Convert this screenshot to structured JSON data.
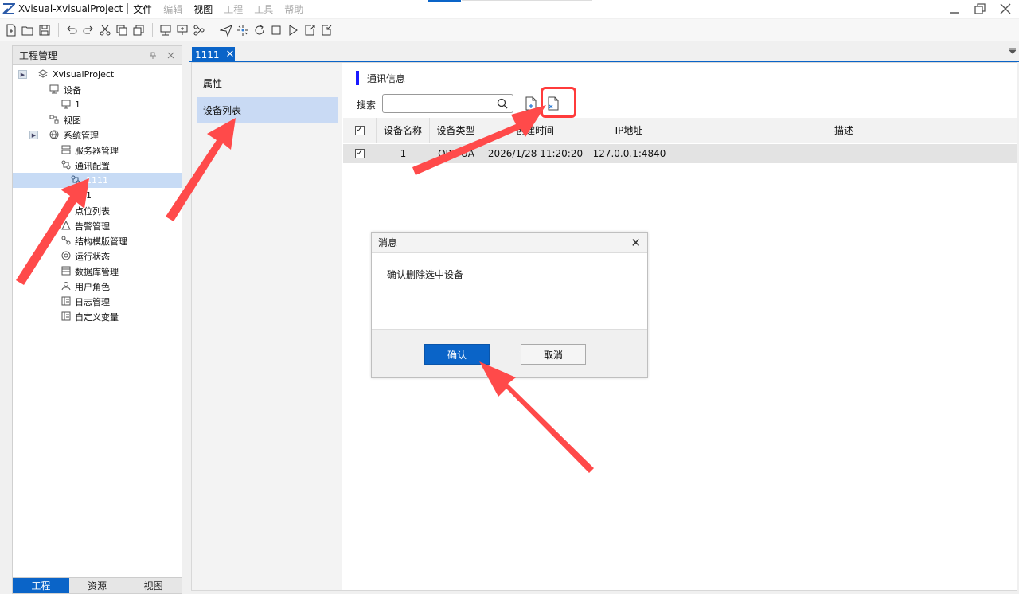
{
  "window": {
    "title": "Xvisual-XvisualProject",
    "menu": [
      {
        "label": "文件",
        "enabled": true
      },
      {
        "label": "编辑",
        "enabled": false
      },
      {
        "label": "视图",
        "enabled": true
      },
      {
        "label": "工程",
        "enabled": false
      },
      {
        "label": "工具",
        "enabled": false
      },
      {
        "label": "帮助",
        "enabled": false
      }
    ]
  },
  "left_panel": {
    "title": "工程管理",
    "tree": [
      {
        "label": "XvisualProject",
        "icon": "layers-icon"
      },
      {
        "label": "设备",
        "icon": "device-icon"
      },
      {
        "label": "1",
        "icon": "device-icon"
      },
      {
        "label": "视图",
        "icon": "view-icon"
      },
      {
        "label": "系统管理",
        "icon": "globe-icon"
      },
      {
        "label": "服务器管理",
        "icon": "server-icon"
      },
      {
        "label": "通讯配置",
        "icon": "network-icon"
      },
      {
        "label": "1111",
        "icon": "network-icon"
      },
      {
        "label": "1",
        "icon": ""
      },
      {
        "label": "点位列表",
        "icon": ""
      },
      {
        "label": "告警管理",
        "icon": "alarm-icon"
      },
      {
        "label": "结构模版管理",
        "icon": "structure-icon"
      },
      {
        "label": "运行状态",
        "icon": "status-icon"
      },
      {
        "label": "数据库管理",
        "icon": "database-icon"
      },
      {
        "label": "用户角色",
        "icon": "user-icon"
      },
      {
        "label": "日志管理",
        "icon": "log-icon"
      },
      {
        "label": "自定义变量",
        "icon": "variable-icon"
      }
    ],
    "bottom_tabs": [
      "工程",
      "资源",
      "视图"
    ]
  },
  "doc_tab": {
    "label": "1111"
  },
  "side_nav": {
    "items": [
      "属性",
      "设备列表"
    ]
  },
  "section": {
    "title": "通讯信息"
  },
  "search": {
    "label": "搜索",
    "value": ""
  },
  "table": {
    "headers": [
      "",
      "设备名称",
      "设备类型",
      "创建时间",
      "IP地址",
      "描述"
    ],
    "rows": [
      {
        "checked": true,
        "name": "1",
        "type": "OPC UA",
        "time": "2026/1/28 11:20:20",
        "ip": "127.0.0.1:4840",
        "desc": ""
      }
    ]
  },
  "dialog": {
    "title": "消息",
    "message": "确认删除选中设备",
    "ok_label": "确认",
    "cancel_label": "取消"
  },
  "colors": {
    "accent": "#0a64c8",
    "annotation": "#ff4a4a",
    "selection": "#c9daf4"
  }
}
